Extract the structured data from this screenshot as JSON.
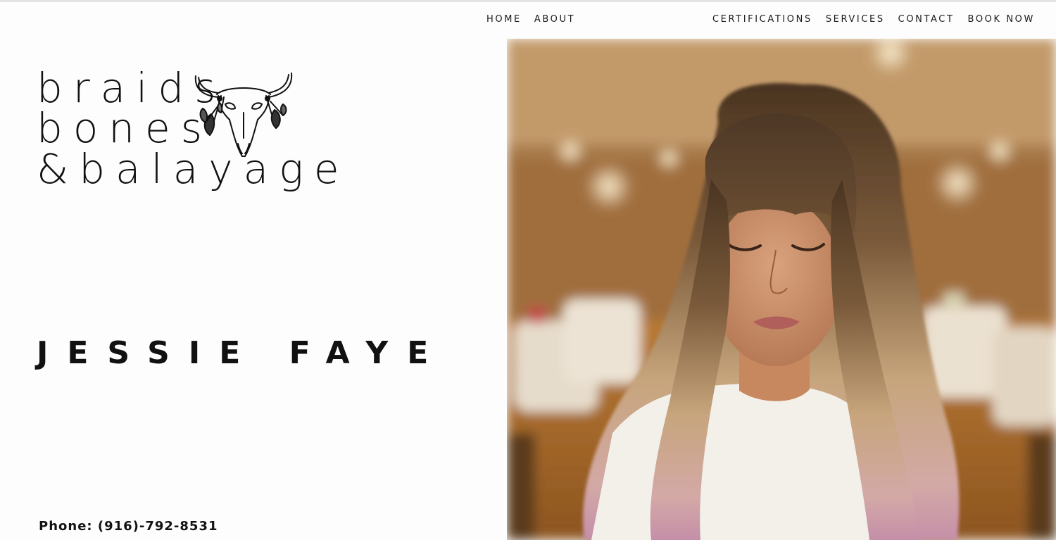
{
  "nav": {
    "left": [
      "HOME",
      "ABOUT"
    ],
    "right": [
      "CERTIFICATIONS",
      "SERVICES",
      "CONTACT",
      "BOOK NOW"
    ]
  },
  "logo": {
    "line1": "braids",
    "line2": "bones",
    "line3": "&balayage",
    "icon": "bull-skull-icon"
  },
  "hero": {
    "name": "JESSIE FAYE",
    "phone": "Phone: (916)-792-8531"
  },
  "photo": {
    "subject": "woman-with-balayage-hair-photo"
  },
  "colors": {
    "text": "#111111",
    "background": "#fdfdfd"
  }
}
